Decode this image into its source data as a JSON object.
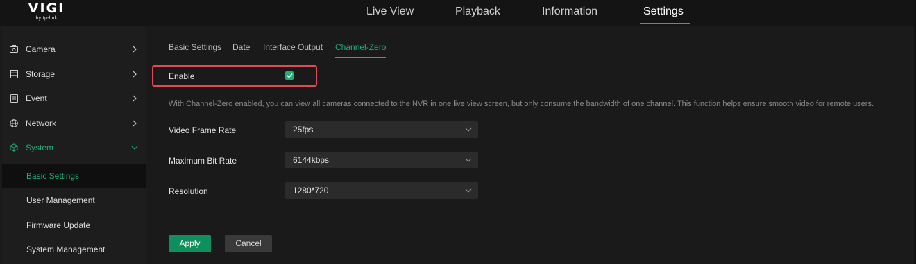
{
  "logo": {
    "main": "VIGI",
    "sub": "by tp-link"
  },
  "nav": {
    "items": [
      {
        "label": "Live View"
      },
      {
        "label": "Playback"
      },
      {
        "label": "Information"
      },
      {
        "label": "Settings"
      }
    ],
    "active": "Settings"
  },
  "sidebar": {
    "items": [
      {
        "label": "Camera",
        "icon": "camera-icon"
      },
      {
        "label": "Storage",
        "icon": "storage-icon"
      },
      {
        "label": "Event",
        "icon": "event-icon"
      },
      {
        "label": "Network",
        "icon": "globe-icon"
      },
      {
        "label": "System",
        "icon": "system-icon"
      }
    ],
    "submenu": [
      {
        "label": "Basic Settings"
      },
      {
        "label": "User Management"
      },
      {
        "label": "Firmware Update"
      },
      {
        "label": "System Management"
      }
    ],
    "active_sub": "Basic Settings"
  },
  "tabs": {
    "items": [
      {
        "label": "Basic Settings"
      },
      {
        "label": "Date"
      },
      {
        "label": "Interface Output"
      },
      {
        "label": "Channel-Zero"
      }
    ],
    "active": "Channel-Zero"
  },
  "form": {
    "enable_label": "Enable",
    "enable_checked": true,
    "description": "With Channel-Zero enabled, you can view all cameras connected to the NVR in one live view screen, but only consume the bandwidth of one channel. This function helps ensure smooth video for remote users.",
    "fields": [
      {
        "label": "Video Frame Rate",
        "value": "25fps"
      },
      {
        "label": "Maximum Bit Rate",
        "value": "6144kbps"
      },
      {
        "label": "Resolution",
        "value": "1280*720"
      }
    ]
  },
  "buttons": {
    "apply": "Apply",
    "cancel": "Cancel"
  },
  "colors": {
    "accent": "#1fae73",
    "highlight_border": "#e04a55",
    "background": "#1a1a1a"
  }
}
